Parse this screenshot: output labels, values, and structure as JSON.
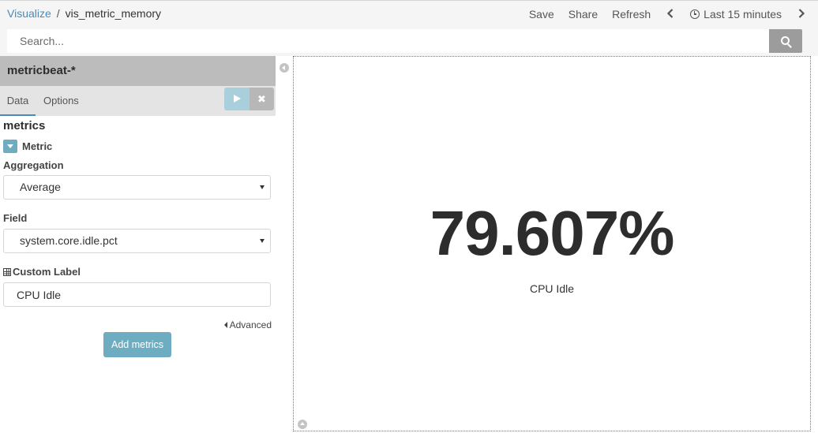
{
  "breadcrumb": {
    "parent": "Visualize",
    "separator": "/",
    "current": "vis_metric_memory"
  },
  "menu": {
    "save": "Save",
    "share": "Share",
    "refresh": "Refresh",
    "time_range": "Last 15 minutes",
    "icons": [
      "chevron-left-icon",
      "clock-icon",
      "chevron-right-icon"
    ]
  },
  "search": {
    "placeholder": "Search...",
    "value": "",
    "icon": "magnifier-icon"
  },
  "sidebar": {
    "index_pattern": "metricbeat-*",
    "tabs": [
      "Data",
      "Options"
    ],
    "section_title": "metrics",
    "metric_toggle_label": "Metric",
    "aggregation_label": "Aggregation",
    "aggregation_value": "Average",
    "field_label": "Field",
    "field_value": "system.core.idle.pct",
    "custom_label_label": "Custom Label",
    "custom_label_value": "CPU Idle",
    "advanced_label": "Advanced",
    "add_metrics_label": "Add metrics",
    "discard_label": "✖"
  },
  "visualization": {
    "value": "79.607%",
    "label": "CPU Idle"
  },
  "colors": {
    "accent": "#4a8ab8",
    "button": "#6eadc1",
    "apply_disabled": "#a9cfdc",
    "header_bg": "#bcbcbc"
  }
}
